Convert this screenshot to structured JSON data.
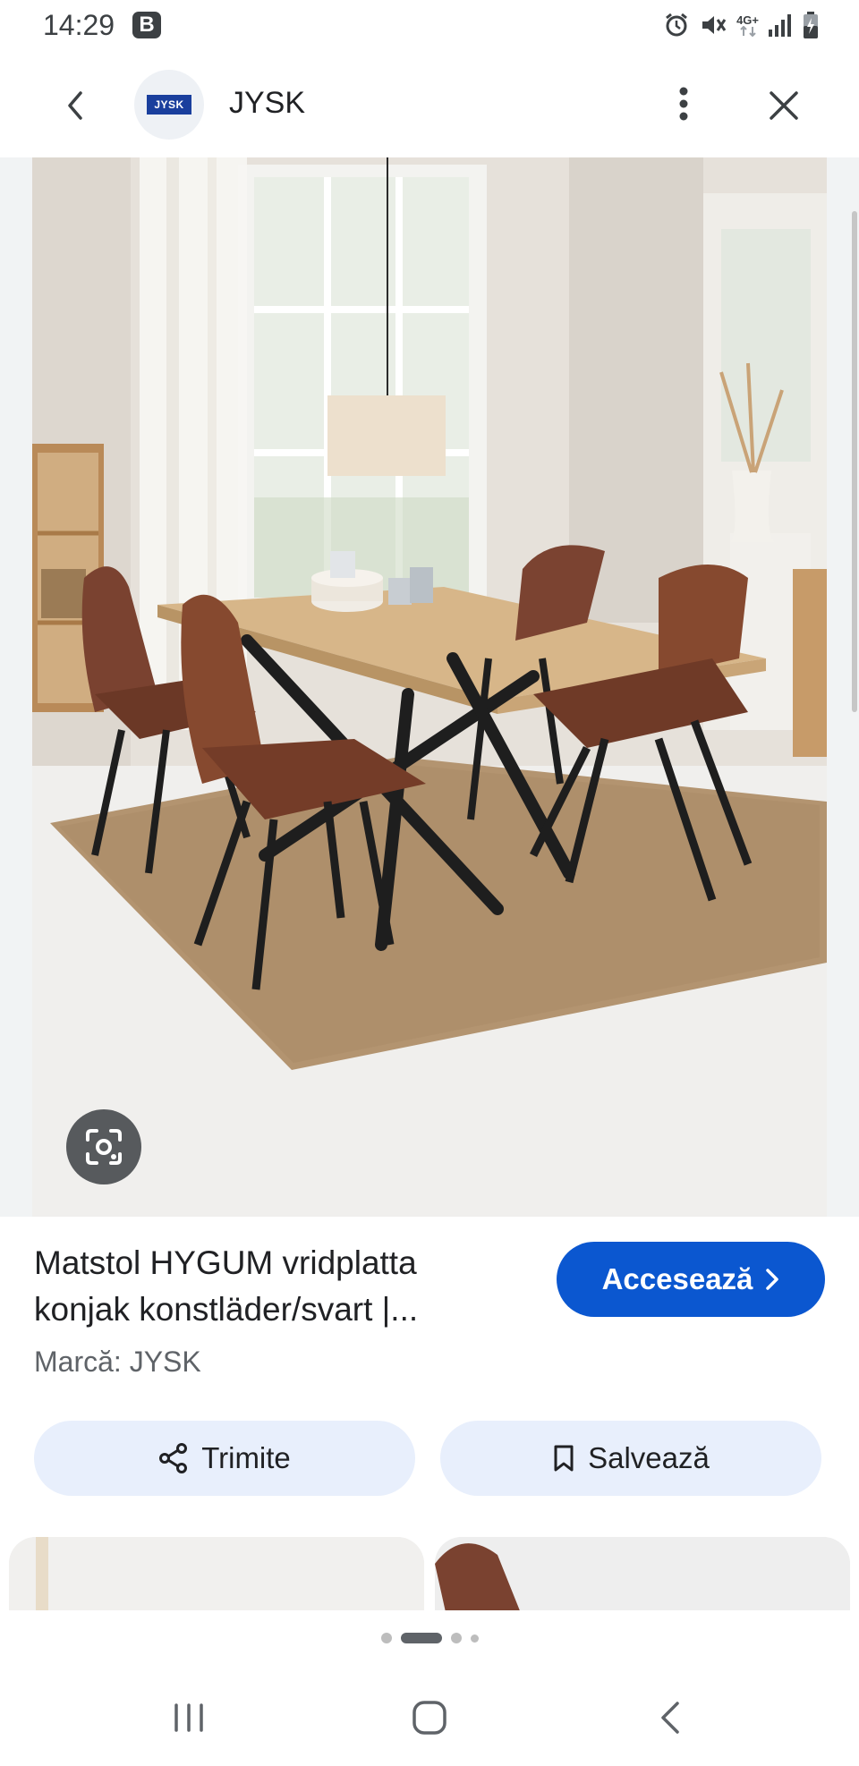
{
  "status_bar": {
    "time": "14:29",
    "badge": "B",
    "network": "4G+",
    "icons": [
      "alarm-icon",
      "mute-icon",
      "network-4g-icon",
      "signal-icon",
      "battery-icon"
    ]
  },
  "header": {
    "logo_text": "JYSK",
    "site_name": "JYSK",
    "icons": [
      "back-arrow-icon",
      "more-vert-icon",
      "close-icon"
    ]
  },
  "image": {
    "alt": "Matstol HYGUM vridplatta konjak konstläder/svart",
    "lens_icon": "google-lens-icon"
  },
  "product": {
    "title_line1": "Matstol HYGUM vridplatta",
    "title_line2": "konjak konstläder/svart |...",
    "brand": "Marcă: JYSK",
    "visit_label": "Accesează",
    "share_label": "Trimite",
    "save_label": "Salvează"
  },
  "colors": {
    "accent": "#0b57d0",
    "chip_bg": "#e8effc"
  },
  "pager": {
    "count": 4,
    "active": 1
  },
  "nav": {
    "icons": [
      "recent-apps-icon",
      "home-icon",
      "back-icon"
    ]
  }
}
